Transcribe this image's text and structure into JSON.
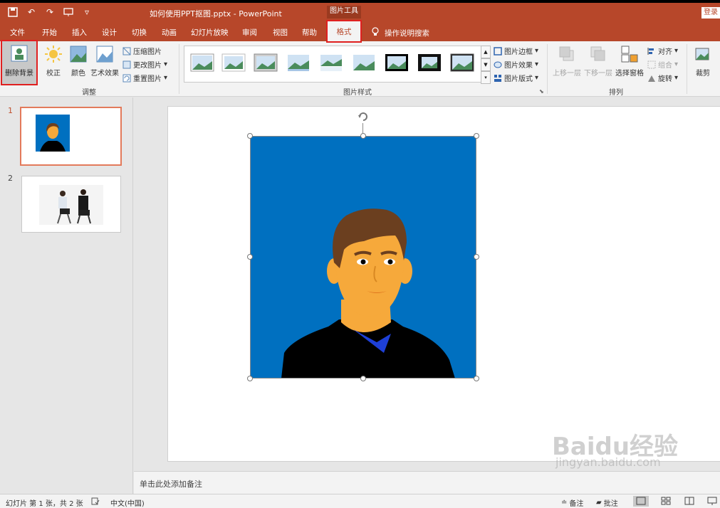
{
  "titlebar": {
    "document_title": "如何使用PPT抠图.pptx  -  PowerPoint",
    "context_group": "图片工具",
    "login": "登录"
  },
  "tabs": [
    "文件",
    "开始",
    "插入",
    "设计",
    "切换",
    "动画",
    "幻灯片放映",
    "审阅",
    "视图",
    "帮助"
  ],
  "active_tab": "格式",
  "tell_me": "操作说明搜索",
  "ribbon": {
    "adjust": {
      "remove_bg": "删除背景",
      "corrections": "校正",
      "color": "颜色",
      "artistic": "艺术效果",
      "compress": "压缩图片",
      "change": "更改图片",
      "reset": "重置图片",
      "label": "调整"
    },
    "styles": {
      "border": "图片边框",
      "effects": "图片效果",
      "layout": "图片版式",
      "label": "图片样式"
    },
    "arrange": {
      "bring_forward": "上移一层",
      "send_backward": "下移一层",
      "selection_pane": "选择窗格",
      "align": "对齐",
      "group": "组合",
      "rotate": "旋转",
      "label": "排列"
    },
    "size": {
      "crop": "裁剪"
    }
  },
  "slides": [
    {
      "number": "1"
    },
    {
      "number": "2"
    }
  ],
  "notes_placeholder": "单击此处添加备注",
  "status": {
    "slide_info": "幻灯片 第 1 张，共 2 张",
    "language": "中文(中国)",
    "notes": "备注",
    "comments": "批注"
  },
  "watermark": {
    "brand": "Baidu经验",
    "url": "jingyan.baidu.com"
  },
  "colors": {
    "accent": "#b7472a",
    "picture_bg": "#0070c0",
    "highlight": "#e02020"
  }
}
